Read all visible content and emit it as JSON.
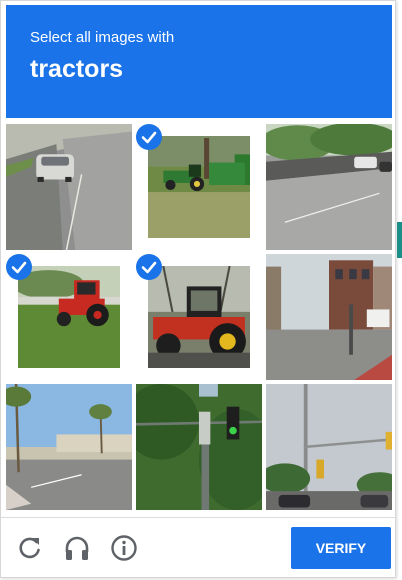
{
  "header": {
    "instruction": "Select all images with",
    "keyword": "tractors",
    "bg_color": "#1a73e8"
  },
  "tiles": [
    {
      "scene": "road-car",
      "selected": false
    },
    {
      "scene": "green-tractor-field",
      "selected": true
    },
    {
      "scene": "highway",
      "selected": false
    },
    {
      "scene": "red-tractor-lawn",
      "selected": true
    },
    {
      "scene": "red-tractor-closeup",
      "selected": true
    },
    {
      "scene": "street-buildings",
      "selected": false
    },
    {
      "scene": "palm-street",
      "selected": false
    },
    {
      "scene": "traffic-light-trees",
      "selected": false
    },
    {
      "scene": "traffic-lights-sky",
      "selected": false
    }
  ],
  "footer": {
    "reload_icon": "reload-icon",
    "audio_icon": "headphones-icon",
    "info_icon": "info-icon",
    "verify_label": "VERIFY"
  }
}
